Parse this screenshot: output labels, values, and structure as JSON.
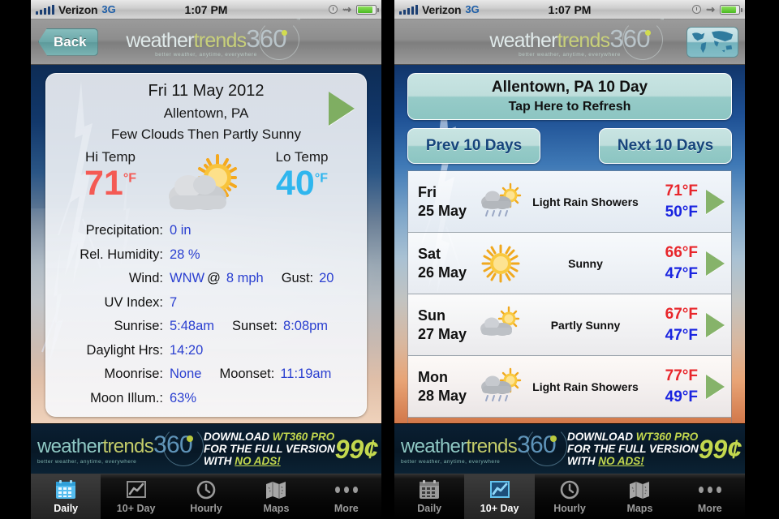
{
  "statusbar": {
    "carrier": "Verizon",
    "network": "3G",
    "time": "1:07 PM",
    "icons": [
      "signal-bars-icon",
      "clock-icon",
      "bluetooth-icon",
      "battery-icon"
    ]
  },
  "brand": {
    "word1": "weather",
    "word2": "trends",
    "word3": "360",
    "tagline": "better weather, anytime, everywhere",
    "tm": "™"
  },
  "left_phone": {
    "navbar": {
      "back_label": "Back"
    },
    "card": {
      "date": "Fri 11 May 2012",
      "city": "Allentown, PA",
      "condition": "Few Clouds Then Partly Sunny",
      "icon": "partly-cloudy-sun-icon",
      "hi_label": "Hi Temp",
      "hi_value": "71",
      "hi_unit": "°F",
      "lo_label": "Lo Temp",
      "lo_value": "40",
      "lo_unit": "°F",
      "details": [
        {
          "label": "Precipitation:",
          "value": "0 in"
        },
        {
          "label": "Rel. Humidity:",
          "value": "28 %"
        },
        {
          "label": "Wind:",
          "value": "WNW",
          "at": "@",
          "value2": "8 mph",
          "label2": "Gust:",
          "value3": "20"
        },
        {
          "label": "UV Index:",
          "value": "7"
        },
        {
          "label": "Sunrise:",
          "value": "5:48am",
          "label2": "Sunset:",
          "value2": "8:08pm"
        },
        {
          "label": "Daylight Hrs:",
          "value": "14:20"
        },
        {
          "label": "Moonrise:",
          "value": "None",
          "label2": "Moonset:",
          "value2": "11:19am"
        },
        {
          "label": "Moon Illum.:",
          "value": "63%"
        }
      ]
    }
  },
  "right_phone": {
    "navbar": {
      "globe_icon": "world-map-icon"
    },
    "refresh": {
      "title": "Allentown, PA 10 Day",
      "subtitle": "Tap Here to Refresh"
    },
    "prev_label": "Prev 10 Days",
    "next_label": "Next 10 Days",
    "forecast": [
      {
        "dow": "Fri",
        "date": "25 May",
        "icon": "rain-sun-icon",
        "condition": "Light Rain Showers",
        "hi": "71°F",
        "lo": "50°F"
      },
      {
        "dow": "Sat",
        "date": "26 May",
        "icon": "sunny-icon",
        "condition": "Sunny",
        "hi": "66°F",
        "lo": "47°F"
      },
      {
        "dow": "Sun",
        "date": "27 May",
        "icon": "partly-cloudy-sun-icon",
        "condition": "Partly Sunny",
        "hi": "67°F",
        "lo": "47°F"
      },
      {
        "dow": "Mon",
        "date": "28 May",
        "icon": "rain-sun-icon",
        "condition": "Light Rain Showers",
        "hi": "77°F",
        "lo": "49°F"
      }
    ]
  },
  "ad": {
    "line1_a": "DOWNLOAD ",
    "line1_b": "WT360 PRO",
    "line2": "FOR THE FULL VERSION",
    "line3_a": "WITH ",
    "line3_b": "NO ADS!",
    "price": "99¢"
  },
  "tabbar": {
    "tabs": [
      {
        "label": "Daily",
        "icon": "calendar-icon"
      },
      {
        "label": "10+ Day",
        "icon": "chart-icon"
      },
      {
        "label": "Hourly",
        "icon": "clock-icon"
      },
      {
        "label": "Maps",
        "icon": "map-icon"
      },
      {
        "label": "More",
        "icon": "ellipsis-icon"
      }
    ],
    "left_active": 0,
    "right_active": 1
  },
  "colors": {
    "hi_temp": "#f45a54",
    "lo_temp": "#2fb6ee",
    "value_blue": "#2a3fd0",
    "list_hi": "#e8262b",
    "list_lo": "#1a24e0",
    "accent_teal": "#8cc5c2",
    "ad_green": "#c3d84e",
    "play_green": "#7fae62"
  }
}
